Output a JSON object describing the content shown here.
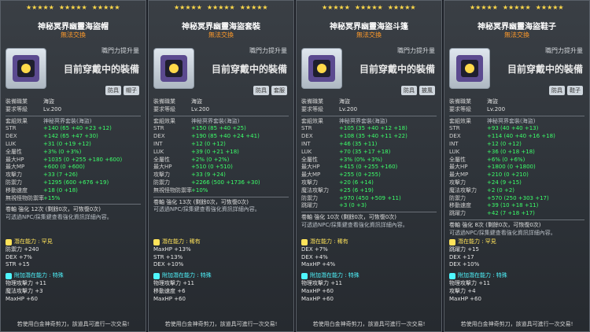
{
  "colors": {
    "star": "#ffd94a",
    "trade": "#ff9a2a",
    "green": "#3cff6a",
    "yellow": "#ffe35a",
    "cyan": "#4ff7ff"
  },
  "panels": [
    {
      "stars": [
        "★★★★★",
        "★★★★★",
        "★★★★★"
      ],
      "title": "神秘冥界幽靈海盜帽",
      "trade": "無法交換",
      "power_label": "職門力提升量",
      "equipped": "目前穿戴中的裝備",
      "tags": [
        "防具",
        "帽子"
      ],
      "job_label": "裝備職業",
      "job_value": "海盜",
      "req_label": "要求等級",
      "req_value": "Lv.200",
      "set_label": "套組效果",
      "set_value": "神秘冥界套裝(海盜)",
      "stats": [
        {
          "k": "STR",
          "v": "+140 (65 +40 +23 +12)"
        },
        {
          "k": "DEX",
          "v": "+142 (65 +47 +30)"
        },
        {
          "k": "LUK",
          "v": "+31 (0 +19 +12)"
        },
        {
          "k": "全屬性",
          "v": "+3% (0 +3%)"
        },
        {
          "k": "最大HP",
          "v": "+1035 (0 +255 +180 +600)"
        },
        {
          "k": "最大MP",
          "v": "+600 (0 +600)"
        },
        {
          "k": "攻擊力",
          "v": "+33 (7 +26)"
        },
        {
          "k": "防禦力",
          "v": "+1295 (600 +676 +19)"
        },
        {
          "k": "移動速度",
          "v": "+18 (0 +18)"
        },
        {
          "k": "無視怪物防禦率",
          "v": "+15%"
        }
      ],
      "scroll": "卷軸 強化 12次 (剩餘0次，可恢復0次)",
      "scroll_note": "可透過NPC/採集鍵查看強化資訊詳細內容。",
      "potential_title": "潛在能力 : 罕見",
      "potential": [
        "防禦力 +240",
        "DEX +7%",
        "STR +15"
      ],
      "bonus_title": "附加潛在能力 : 特殊",
      "bonus": [
        "物理攻擊力 +11",
        "魔法攻擊力 +3",
        "MaxHP +60"
      ],
      "footer": "若使用白金神奇剪刀，該道具可進行一次交易!"
    },
    {
      "stars": [
        "★★★★★",
        "★★★★★",
        "★★★★★"
      ],
      "title": "神秘冥界幽靈海盜套裝",
      "trade": "無法交換",
      "power_label": "職門力提升量",
      "equipped": "目前穿戴中的裝備",
      "tags": [
        "防具",
        "套服"
      ],
      "job_label": "裝備職業",
      "job_value": "海盜",
      "req_label": "要求等級",
      "req_value": "Lv.200",
      "set_label": "套組效果",
      "set_value": "神秘冥界套裝(海盜)",
      "stats": [
        {
          "k": "STR",
          "v": "+150 (85 +40 +25)"
        },
        {
          "k": "DEX",
          "v": "+190 (85 +40 +24 +41)"
        },
        {
          "k": "INT",
          "v": "+12 (0 +12)"
        },
        {
          "k": "LUK",
          "v": "+39 (0 +21 +18)"
        },
        {
          "k": "全屬性",
          "v": "+2% (0 +2%)"
        },
        {
          "k": "最大HP",
          "v": "+510 (0 +510)"
        },
        {
          "k": "攻擊力",
          "v": "+33 (9 +24)"
        },
        {
          "k": "防禦力",
          "v": "+2266 (500 +1736 +30)"
        },
        {
          "k": "無視怪物防禦率",
          "v": "+10%"
        }
      ],
      "scroll": "卷軸 強化 13次 (剩餘0次，可恢復0次)",
      "scroll_note": "可透過NPC/採集鍵查看強化資訊詳細內容。",
      "potential_title": "潛在能力 : 稀有",
      "potential": [
        "MaxHP +13%",
        "STR +13%",
        "DEX +10%"
      ],
      "bonus_title": "附加潛在能力 : 特殊",
      "bonus": [
        "物理攻擊力 +11",
        "移動速度 +6",
        "MaxHP +60"
      ],
      "footer": "若使用白金神奇剪刀，該道具可進行一次交易!"
    },
    {
      "stars": [
        "★★★★★",
        "★★★★★",
        "★★★★★"
      ],
      "title": "神秘冥界幽靈海盜斗篷",
      "trade": "無法交換",
      "power_label": "職門力提升量",
      "equipped": "目前穿戴中的裝備",
      "tags": [
        "防具",
        "披風"
      ],
      "job_label": "裝備職業",
      "job_value": "海盜",
      "req_label": "要求等級",
      "req_value": "Lv.200",
      "set_label": "套組效果",
      "set_value": "神秘冥界套裝(海盜)",
      "stats": [
        {
          "k": "STR",
          "v": "+105 (35 +40 +12 +18)"
        },
        {
          "k": "DEX",
          "v": "+108 (35 +40 +11 +22)"
        },
        {
          "k": "INT",
          "v": "+46 (35 +11)"
        },
        {
          "k": "LUK",
          "v": "+70 (35 +17 +18)"
        },
        {
          "k": "全屬性",
          "v": "+3% (0% +3%)"
        },
        {
          "k": "最大HP",
          "v": "+415 (0 +255 +160)"
        },
        {
          "k": "最大MP",
          "v": "+255 (0 +255)"
        },
        {
          "k": "攻擊力",
          "v": "+20 (6 +14)"
        },
        {
          "k": "魔法攻擊力",
          "v": "+25 (6 +19)"
        },
        {
          "k": "防禦力",
          "v": "+970 (450 +509 +11)"
        },
        {
          "k": "跳躍力",
          "v": "+3 (0 +3)"
        }
      ],
      "scroll": "卷軸 強化 10次 (剩餘0次，可恢復0次)",
      "scroll_note": "可透過NPC/採集鍵查看強化資訊詳細內容。",
      "potential_title": "潛在能力 : 稀有",
      "potential": [
        "DEX +7%",
        "DEX +4%",
        "MaxHP +4%"
      ],
      "bonus_title": "附加潛在能力 : 特殊",
      "bonus": [
        "物理攻擊力 +11",
        "MaxHP +60",
        "MaxHP +60"
      ],
      "footer": "若使用白金神奇剪刀，該道具可進行一次交易!"
    },
    {
      "stars": [
        "★★★★★",
        "★★★★★",
        "★★★★★"
      ],
      "title": "神秘冥界幽靈海盜鞋子",
      "trade": "無法交換",
      "power_label": "職門力提升量",
      "equipped": "目前穿戴中的裝備",
      "tags": [
        "防具",
        "鞋子"
      ],
      "job_label": "裝備職業",
      "job_value": "海盜",
      "req_label": "要求等級",
      "req_value": "Lv.200",
      "set_label": "套組效果",
      "set_value": "神秘冥界套裝(海盜)",
      "stats": [
        {
          "k": "STR",
          "v": "+93 (40 +40 +13)"
        },
        {
          "k": "DEX",
          "v": "+114 (40 +40 +16 +18)"
        },
        {
          "k": "INT",
          "v": "+12 (0 +12)"
        },
        {
          "k": "LUK",
          "v": "+36 (0 +18 +18)"
        },
        {
          "k": "全屬性",
          "v": "+6% (0 +6%)"
        },
        {
          "k": "最大HP",
          "v": "+1800 (0 +1800)"
        },
        {
          "k": "最大MP",
          "v": "+210 (0 +210)"
        },
        {
          "k": "攻擊力",
          "v": "+24 (9 +15)"
        },
        {
          "k": "魔法攻擊力",
          "v": "+2 (0 +2)"
        },
        {
          "k": "防禦力",
          "v": "+570 (250 +303 +17)"
        },
        {
          "k": "移動速度",
          "v": "+39 (10 +18 +11)"
        },
        {
          "k": "跳躍力",
          "v": "+42 (7 +18 +17)"
        }
      ],
      "scroll": "卷軸 強化 8次 (剩餘0次，可恢復0次)",
      "scroll_note": "可透過NPC/採集鍵查看強化資訊詳細內容。",
      "potential_title": "潛在能力 : 罕見",
      "potential": [
        "跳躍力 +15",
        "DEX +17",
        "DEX +10%"
      ],
      "bonus_title": "附加潛在能力 : 特殊",
      "bonus": [
        "物理攻擊力 +11",
        "攻擊力 +4",
        "MaxHP +60"
      ],
      "footer": "若使用白金神奇剪刀，該道具可進行一次交易!"
    }
  ]
}
